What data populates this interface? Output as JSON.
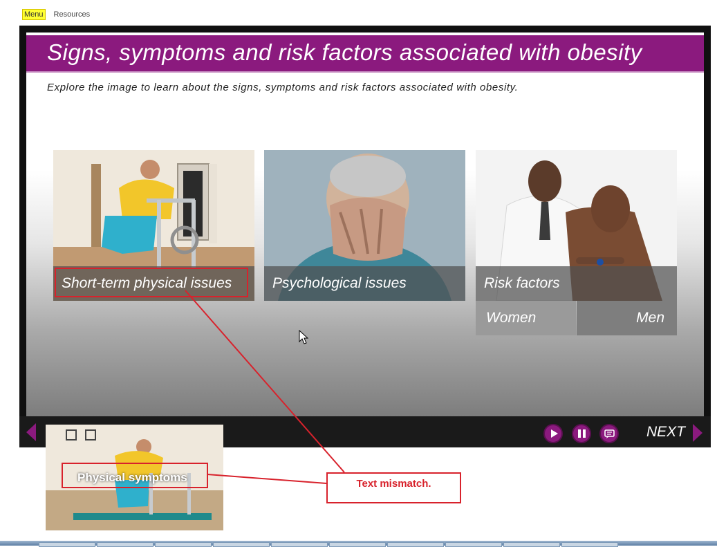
{
  "top_nav": {
    "menu_label": "Menu",
    "resources_label": "Resources"
  },
  "slide": {
    "title": "Signs, symptoms and risk factors associated with obesity",
    "instruction": "Explore the image to learn about the signs, symptoms and risk factors associated with obesity.",
    "cards": [
      {
        "label": "Short-term physical issues",
        "icon": "woman-exercising-photo"
      },
      {
        "label": "Psychological issues",
        "icon": "man-covering-face-photo"
      },
      {
        "label": "Risk factors",
        "icon": "doctor-patient-photo"
      }
    ],
    "risk_subbuttons": {
      "women": "Women",
      "men": "Men"
    }
  },
  "player_controls": {
    "next_label": "NEXT",
    "icons": [
      "prev-arrow-icon",
      "play-icon",
      "pause-icon",
      "captions-icon",
      "next-arrow-icon"
    ]
  },
  "annotation": {
    "inset_label": "Physical symptoms",
    "note": "Text mismatch."
  },
  "colors": {
    "brand_purple": "#8b1a7e",
    "annotation_red": "#d8222c",
    "menu_highlight": "#ffff33"
  }
}
